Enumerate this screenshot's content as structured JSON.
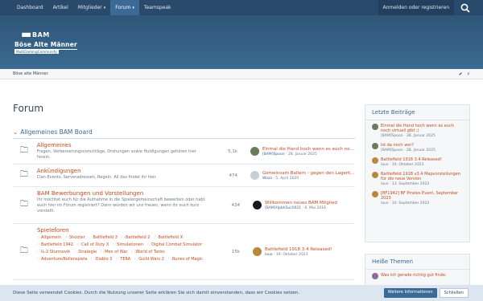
{
  "nav": {
    "items": [
      {
        "label": "Dashboard"
      },
      {
        "label": "Artikel"
      },
      {
        "label": "Mitglieder"
      },
      {
        "label": "Forum"
      },
      {
        "label": "Teamspeak"
      }
    ],
    "login": "Anmelden oder registrieren"
  },
  "logo": {
    "line1": "BAM",
    "line2": "Böse Alte Männer",
    "line3": "MultiGamingCommunity"
  },
  "breadcrumb": "Böse alte Männer",
  "page_title": "Forum",
  "section": "Allgemeines BAM Board",
  "nodes": [
    {
      "title": "Allgemeines",
      "desc": "Fragen, Verbesserungsvorschläge, Drohungen sowie Huldigungen gehören hier hinein.",
      "count": "5,1k",
      "last_title": "Einmal die Hand hoch wenn es euch noch...",
      "last_user": "[BAM]Spoon",
      "last_date": "28. Januar 2025"
    },
    {
      "title": "Ankündigungen",
      "desc": "Clan-Events, Serveradressen, Regeln. All das findet ihr hier.",
      "count": "474",
      "last_title": "Gemeinsam Ballern - gegen den Lagerkoller",
      "last_user": "Waza",
      "last_date": "5. April 2020"
    },
    {
      "title": "BAM Bewerbungen und Vorstellungen",
      "desc": "Ihr möchtet euch für die Aufnahme in die Spielergemeinschaft bewerben oder habt euch hier im Forum registriert? Dann würden wir uns freuen, wenn ihr euch kurz vorstellt.",
      "count": "434",
      "last_title": "Willkommen neues BAM Mitglied",
      "last_user": "[BAM]HpbhSuch021",
      "last_date": "6. Mai 2016"
    },
    {
      "title": "Spieleforen",
      "subforums": [
        "Allgemein",
        "Shooter",
        "Battlefield 3",
        "Battlefield 2",
        "Battlefield X",
        "Battlefield 1942",
        "Call of Duty X",
        "Simulationen",
        "Digital Combat Simulator",
        "IL-2 Sturmovik",
        "Strategie",
        "Men of War",
        "World of Tanks",
        "Adventure/Rollenspiele",
        "Diablo 3",
        "TERA",
        "Guild Wars 2",
        "Runes of Magic"
      ],
      "count": "15k",
      "last_title": "Battlefield 1918 3.4 Released!",
      "last_user": "laux",
      "last_date": "19. Oktober 2023"
    }
  ],
  "sidebar": {
    "latest_title": "Letzte Beiträge",
    "posts": [
      {
        "title": "Einmal die Hand hoch wenn es euch noch virtuell gibt ;)",
        "user": "[BAM]Spoon",
        "date": "28. Januar 2025"
      },
      {
        "title": "Ist da noch wer?",
        "user": "[BAM]Spoon",
        "date": "28. Januar 2025"
      },
      {
        "title": "Battlefield 1918 3.4 Released!",
        "user": "laux",
        "date": "19. Oktober 2023"
      },
      {
        "title": "Battlefield 1918 v3.4 Mapvorstellungen für die neue Version",
        "user": "laux",
        "date": "13. September 2023"
      },
      {
        "title": "[BF1942] BF Pirates Event, September 2023",
        "user": "laux",
        "date": "10. September 2023"
      }
    ],
    "hot_title": "Heiße Themen",
    "hot_post": "Was ich gerade richtig gut finde:"
  },
  "cookie": {
    "text": "Diese Seite verwendet Cookies. Durch die Nutzung unserer Seite erklären Sie sich damit einverstanden, dass wir Cookies setzen.",
    "more": "Weitere Informationen",
    "close": "Schließen"
  },
  "colors": {
    "nav": "#2a4a6b",
    "header": "#3a6a92",
    "accent": "#c84a1e",
    "link": "#3c6a96"
  }
}
